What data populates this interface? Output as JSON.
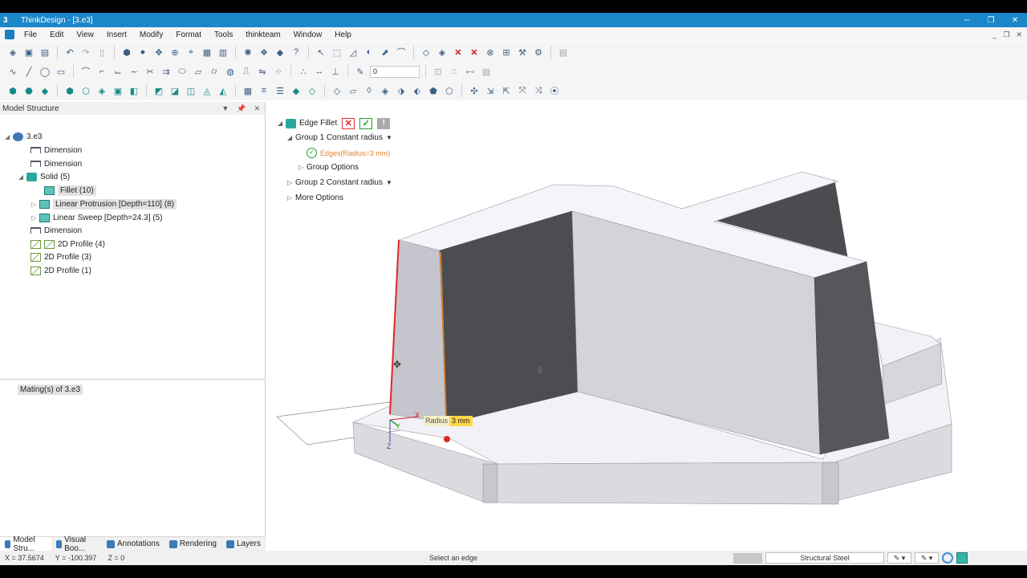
{
  "window": {
    "app_icon": "3",
    "title": "ThinkDesign - [3.e3]",
    "min": "─",
    "max": "❐",
    "close": "✕"
  },
  "menu": [
    "File",
    "Edit",
    "View",
    "Insert",
    "Modify",
    "Format",
    "Tools",
    "thinkteam",
    "Window",
    "Help"
  ],
  "mdi_buttons": {
    "min": "_",
    "restore": "❐",
    "close": "✕"
  },
  "toolbar": {
    "layer_value": "0"
  },
  "model_structure": {
    "title": "Model Structure",
    "header_buttons": {
      "dropdown": "▼",
      "pin": "📌",
      "close": "✕"
    },
    "tree": {
      "root": "3.e3",
      "dim1": "Dimension",
      "dim2": "Dimension",
      "solid": "Solid (5)",
      "fillet": "Fillet (10)",
      "protrusion": "Linear Protrusion [Depth=110] (8)",
      "sweep": "Linear Sweep [Depth=24.3] (5)",
      "dim3": "Dimension",
      "prof4": "2D Profile (4)",
      "prof3": "2D Profile (3)",
      "prof1": "2D Profile (1)"
    },
    "mating": "Mating(s) of 3.e3"
  },
  "bottom_tabs": [
    "Model Stru...",
    "Visual Boo...",
    "Annotations",
    "Rendering",
    "Layers"
  ],
  "edge_fillet": {
    "title": "Edge Fillet",
    "cancel": "✕",
    "ok": "✓",
    "info": "!",
    "group1": "Group 1 Constant radius",
    "edges": "Edges(Radius=3 mm)",
    "group_options": "Group Options",
    "group2": "Group 2 Constant radius",
    "more_options": "More Options"
  },
  "radius_tag": {
    "label": "Radius",
    "value": "3 mm"
  },
  "triad": {
    "x": "X",
    "y": "Y",
    "z": "Z"
  },
  "status": {
    "x": "X = 37.5674",
    "y": "Y = -100.397",
    "z": "Z = 0",
    "message": "Select an edge",
    "material": "Structural Steel"
  },
  "colors": {
    "accent": "#1a87c8",
    "selection": "#e02828",
    "highlight": "#e0842f"
  }
}
